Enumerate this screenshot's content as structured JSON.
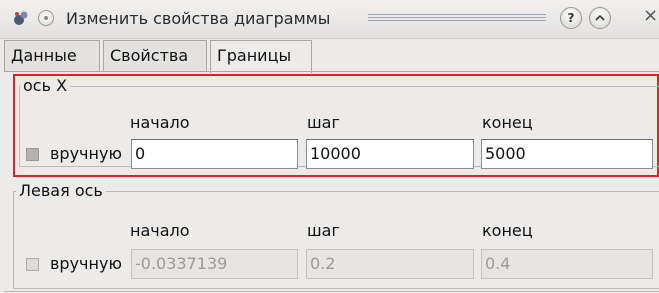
{
  "window": {
    "title": "Изменить свойства диаграммы",
    "help_symbol": "?",
    "shade_symbol": "^",
    "close_symbol": "×"
  },
  "tabs": [
    {
      "label": "Данные",
      "active": false
    },
    {
      "label": "Свойства",
      "active": false
    },
    {
      "label": "Границы",
      "active": true
    }
  ],
  "x_axis": {
    "title": "ось X",
    "manual_label": "вручную",
    "manual_checked": false,
    "start_label": "начало",
    "step_label": "шаг",
    "end_label": "конец",
    "start_value": "0",
    "step_value": "10000",
    "end_value": "5000",
    "enabled": true
  },
  "left_axis": {
    "title": "Левая ось",
    "manual_label": "вручную",
    "manual_checked": false,
    "start_label": "начало",
    "step_label": "шаг",
    "end_label": "конец",
    "start_value": "-0.0337139",
    "step_value": "0.2",
    "end_value": "0.4",
    "enabled": false
  },
  "colors": {
    "highlight_border": "#d62727",
    "window_bg": "#ecebea"
  }
}
